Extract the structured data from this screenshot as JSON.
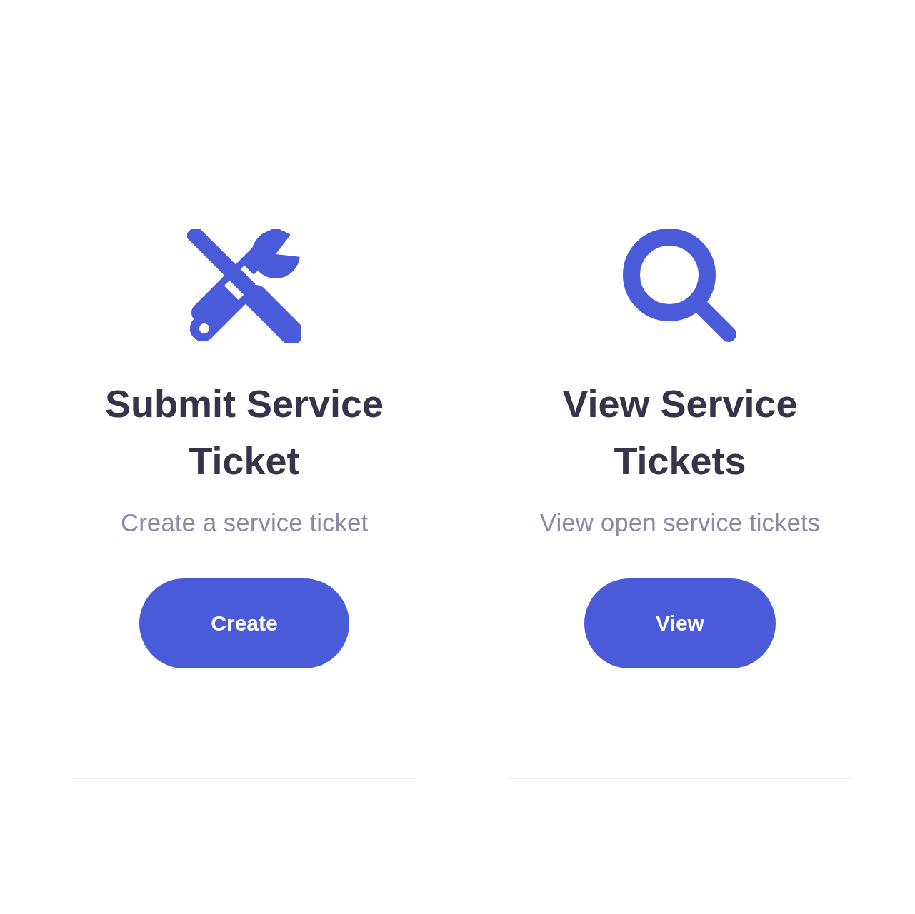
{
  "cards": [
    {
      "kind": "tools",
      "title": "Submit Service Ticket",
      "description": "Create a service ticket",
      "button": "Create"
    },
    {
      "kind": "search",
      "title": "View Service Tickets",
      "description": "View open service tickets",
      "button": "View"
    }
  ]
}
